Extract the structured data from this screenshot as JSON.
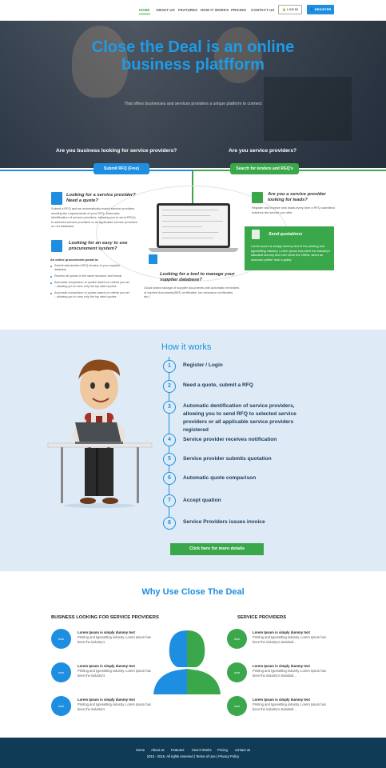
{
  "nav": {
    "items": [
      "HOME",
      "ABOUT US",
      "FEATURES",
      "HOW IT WORKS",
      "PRICING",
      "CONTACT US"
    ],
    "login": "LOG IN",
    "register": "REGISTER"
  },
  "hero": {
    "title_line1": "Close the Deal is an online",
    "title_line2": "business platfform",
    "subtitle": "That offers businesses and services providers a unique platform to connect",
    "question_left": "Are you business looking for service providers?",
    "question_right": "Are you service providers?"
  },
  "process": {
    "btn_left": "Submit RFQ (Free)",
    "btn_right": "Search for tenders and RGQ's",
    "block1_title": "Looking for a service provider? Need a quote?",
    "block1_text": "Submit a RFQ and we automatically match service providers meeting the requirements of your RFQ. Automatic identification of service providers, allowing you to send RFQ's to selected service providers or all applicable service providers on our database.",
    "block2_title": "Looking for an easy to use procurement system?",
    "block2_lead": "An online procurement portal to:",
    "block2_items": [
      "Submit standardized RFQ tenders to your supplier database",
      "Receive all quotes in the same structure and format",
      "Automatic comparison of quotes based on criteria you set – allowing you to view only the top rated quotes",
      "Automatic comparison of quotes based on criteria you set – allowing you to view only the top rated quotes"
    ],
    "block3_title": "Are you a service provider looking for leads?",
    "block3_text": "Register and receive new leads every time a RFQ submitted matches the service you offer",
    "green_title": "Send quotations",
    "green_text": "Lorem Ipsum is simply dummy text of the printing and typesetting industry. Lorem Ipsum has been the industry's standard dummy text ever since the 1500s, when an unknown printer took a galley",
    "block4_title": "Looking for a tool to manage your supplier database?",
    "block4_text": "Cloud based storage of supplier documents with automatic reminders of expired documents(BEE certificates, tax clearance certificates, etc.)"
  },
  "how": {
    "title": "How it works",
    "steps": [
      "Register / Login",
      "Need a quote, submit a RFQ",
      "Automatic dentification of service providers, allowing you to send RFQ to selected service providers or all applicable service providers registered",
      "Service provider receives notification",
      "Service provider submits quotation",
      "Automatic quote comparison",
      "Accept quation",
      "Service Providers issues invoice"
    ],
    "button": "Click here for more details"
  },
  "why": {
    "title": "Why Use Close The Deal",
    "left_head": "BUSINESS LOOKING FOR SERVICE PROVIDERS",
    "right_head": "SERVICE PROVIDERS",
    "icon_label": "icon",
    "item_head": "Lorem Ipsum is simply dummy text",
    "item_text": "Printing and typesetting industry. Lorem Ipsum has been the industry's",
    "item_text_right": "Printing and typesetting industry. Lorem Ipsum has been the industry's standard..."
  },
  "footer": {
    "links": [
      "Home",
      "About us",
      "Features",
      "How it Works",
      "Pricing",
      "contact us"
    ],
    "copy": "2015 - 2016. All rights reserved | Terms of Use | Privacy Policy"
  },
  "colors": {
    "blue": "#1e8fe0",
    "green": "#3aa84a",
    "footer": "#0f3b56",
    "how_bg": "#deebf6"
  }
}
